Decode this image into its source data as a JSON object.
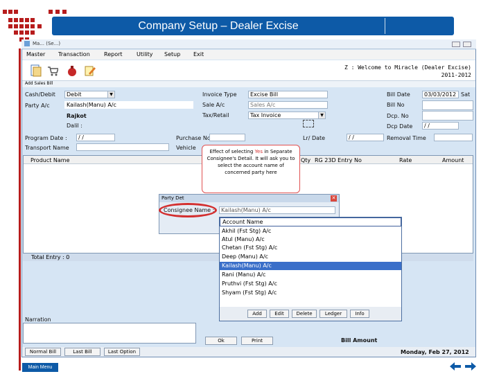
{
  "slide": {
    "title": "Company Setup – Dealer Excise",
    "main_menu_label": "Main Menu"
  },
  "app": {
    "window_title": "Ma... (Se...)",
    "menu": [
      "Master",
      "Transaction",
      "Report",
      "Utility",
      "Setup",
      "Exit"
    ],
    "welcome": "Z : Welcome to Miracle (Dealer Excise)",
    "year": "2011-2012",
    "form_title": "Add Sales Bill"
  },
  "form": {
    "cash_debit_label": "Cash/Debit",
    "cash_debit_value": "Debit",
    "party_label": "Party A/c",
    "party_value": "Kailash(Manu) A/c",
    "city_value": "Rajkot",
    "dalil_label": "Dalil :",
    "invoice_type_label": "Invoice Type",
    "invoice_type_value": "Excise Bill",
    "sale_ac_label": "Sale A/c",
    "sale_ac_value": "Sales A/c",
    "tax_retail_label": "Tax/Retail",
    "tax_retail_value": "Tax Invoice",
    "bill_date_label": "Bill Date",
    "bill_date_value": "03/03/2012",
    "bill_date_day": "Sat",
    "bill_no_label": "Bill No",
    "dcp_no_label": "Dcp. No",
    "dcp_date_label": "Dcp Date",
    "dcp_date_value": "/ /",
    "po_date_label": "Program Date :",
    "po_date_value": "/ /",
    "po_no_label": "Purchase No",
    "lr_date_label": "Lr/ Date",
    "lr_date_value": "/ /",
    "removal_time_label": "Removal Time",
    "transport_label": "Transport Name",
    "vehicle_label": "Vehicle"
  },
  "grid": {
    "columns": [
      "Product Name",
      "Qty",
      "RG 23D Entry No",
      "Rate",
      "Amount"
    ],
    "total_label": "Total Entry : 0"
  },
  "callout": {
    "text_before": "Effect of selecting",
    "yes": "Yes",
    "text_after": "in Separate Consignee's Detail. It will ask you to select the account name of concerned party here"
  },
  "party_dialog": {
    "title": "Party Det",
    "label": "Consignee Name :",
    "value": "Kailash(Manu) A/c"
  },
  "account_list": {
    "header": "Account Name",
    "items": [
      "Akhil (Fst Stg) A/c",
      "Atul (Manu) A/c",
      "Chetan (Fst Stg) A/c",
      "Deep (Manu) A/c",
      "Kailash(Manu) A/c",
      "Rani (Manu) A/c",
      "Pruthvi (Fst Stg) A/c",
      "Shyam (Fst Stg) A/c"
    ],
    "selected_index": 4,
    "buttons": [
      "Add",
      "Edit",
      "Delete",
      "Ledger",
      "Info"
    ]
  },
  "bottom": {
    "narration_label": "Narration",
    "ok_label": "Ok",
    "print_label": "Print",
    "bill_amount_label": "Bill Amount",
    "tabs": [
      "Normal Bill",
      "Last Bill",
      "Last Option"
    ],
    "datetime": "Monday, Feb 27, 2012"
  },
  "colors": {
    "header_blue": "#0d5aa7",
    "accent_red": "#b71c1c",
    "selection_blue": "#3a6fc9"
  }
}
